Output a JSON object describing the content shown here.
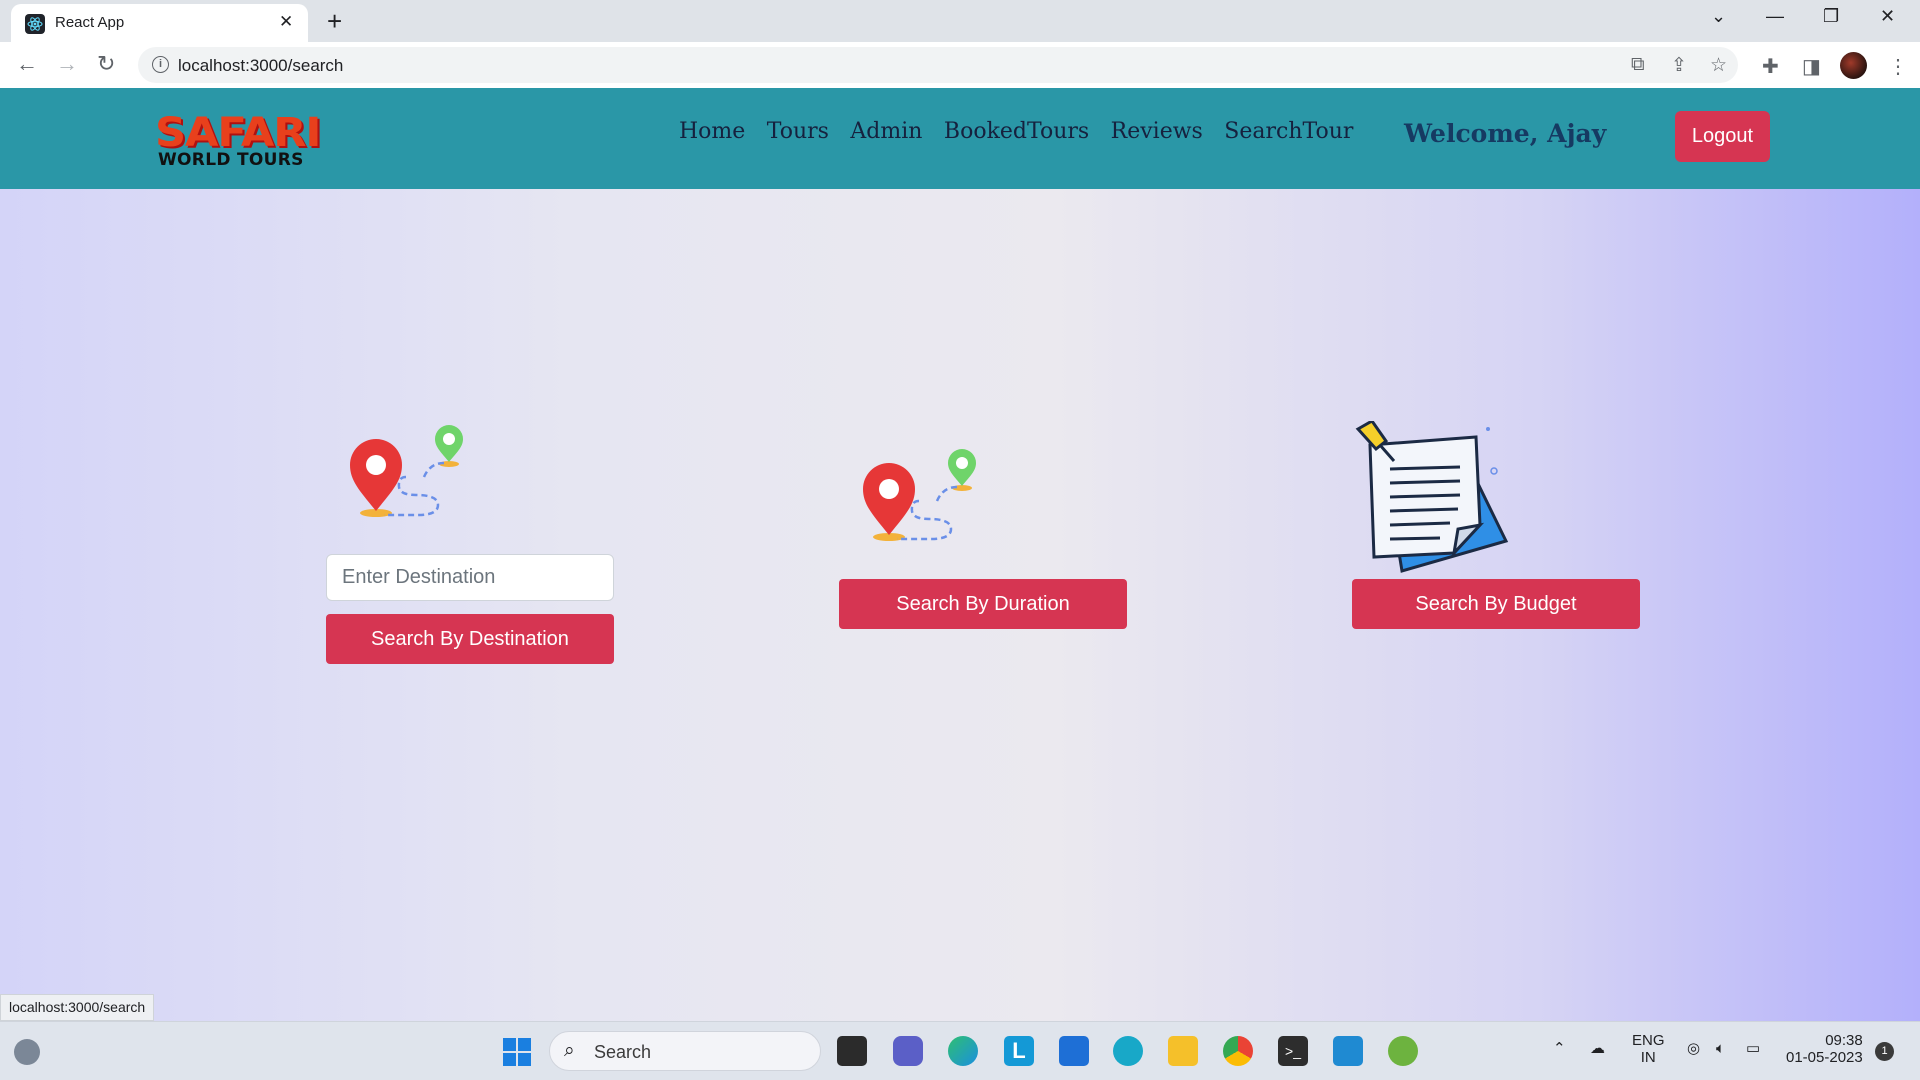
{
  "browser": {
    "tab_title": "React App",
    "tab_close": "✕",
    "new_tab": "+",
    "url": "localhost:3000/search",
    "status_url": "localhost:3000/search",
    "window_controls": [
      "⌄",
      "—",
      "❐",
      "✕"
    ]
  },
  "navbar": {
    "logo_top": "SAFARI",
    "logo_bottom": "WORLD TOURS",
    "links": [
      "Home",
      "Tours",
      "Admin",
      "BookedTours",
      "Reviews",
      "SearchTour"
    ],
    "welcome": "Welcome, Ajay",
    "logout_label": "Logout"
  },
  "search": {
    "destination_placeholder": "Enter Destination",
    "destination_button": "Search By Destination",
    "duration_button": "Search By Duration",
    "budget_button": "Search By Budget"
  },
  "taskbar": {
    "search_label": "Search",
    "lang_line1": "ENG",
    "lang_line2": "IN",
    "time": "09:38",
    "date": "01-05-2023",
    "notification_count": "1"
  },
  "colors": {
    "navbar_bg": "#2a97a7",
    "button_red": "#d63552",
    "welcome_text": "#163a62"
  }
}
